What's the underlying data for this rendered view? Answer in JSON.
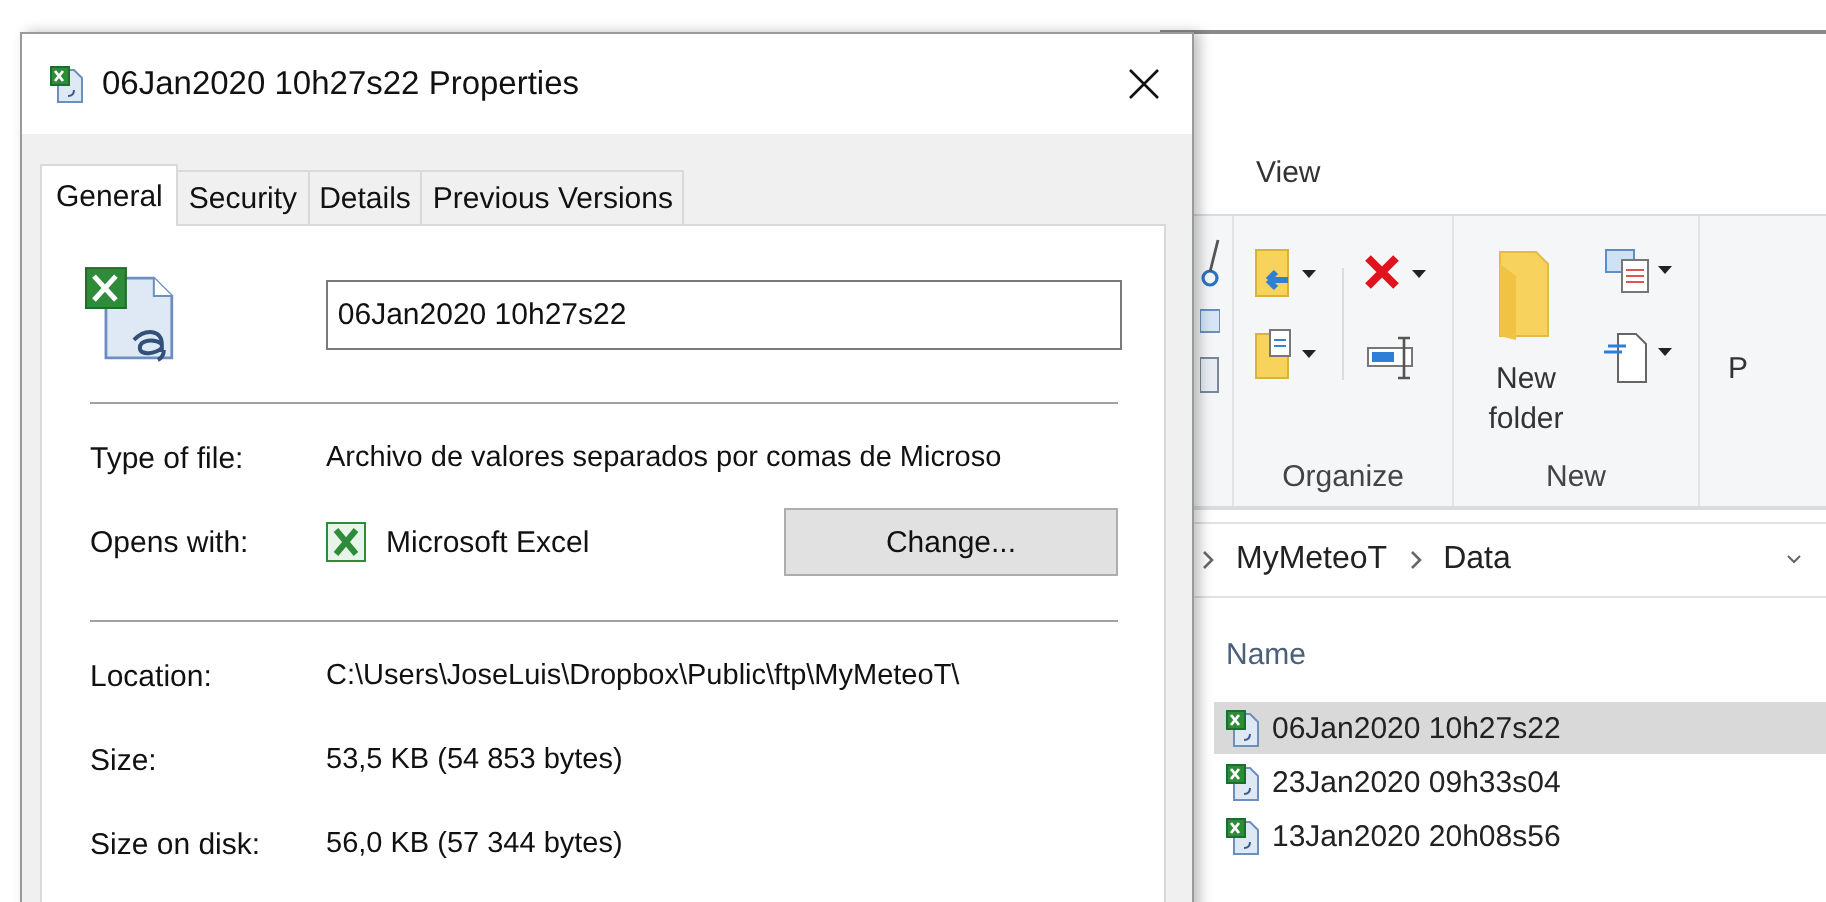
{
  "explorer": {
    "ribbon_tab": "View",
    "groups": [
      {
        "label": "Organize",
        "kind": "organize"
      },
      {
        "label": "New",
        "kind": "new",
        "button": "New folder"
      }
    ],
    "cut_label": "P",
    "breadcrumb": [
      "MyMeteoT",
      "Data"
    ],
    "column": "Name",
    "files": [
      {
        "name": "06Jan2020 10h27s22",
        "selected": true
      },
      {
        "name": "23Jan2020 09h33s04",
        "selected": false
      },
      {
        "name": "13Jan2020 20h08s56",
        "selected": false
      }
    ]
  },
  "dialog": {
    "title": "06Jan2020 10h27s22 Properties",
    "tabs": [
      {
        "label": "General",
        "selected": true
      },
      {
        "label": "Security",
        "selected": false
      },
      {
        "label": "Details",
        "selected": false
      },
      {
        "label": "Previous Versions",
        "selected": false
      }
    ],
    "file_name": "06Jan2020 10h27s22",
    "sections": [
      [
        {
          "label": "Type of file:",
          "value": "Archivo de valores separados por comas de Microso",
          "kind": "text"
        },
        {
          "label": "Opens with:",
          "value": "Microsoft Excel",
          "kind": "app",
          "button": "Change..."
        }
      ],
      [
        {
          "label": "Location:",
          "value": "C:\\Users\\JoseLuis\\Dropbox\\Public\\ftp\\MyMeteoT\\",
          "kind": "text"
        },
        {
          "label": "Size:",
          "value": "53,5 KB (54 853 bytes)",
          "kind": "text"
        },
        {
          "label": "Size on disk:",
          "value": "56,0 KB (57 344 bytes)",
          "kind": "text"
        }
      ]
    ]
  }
}
